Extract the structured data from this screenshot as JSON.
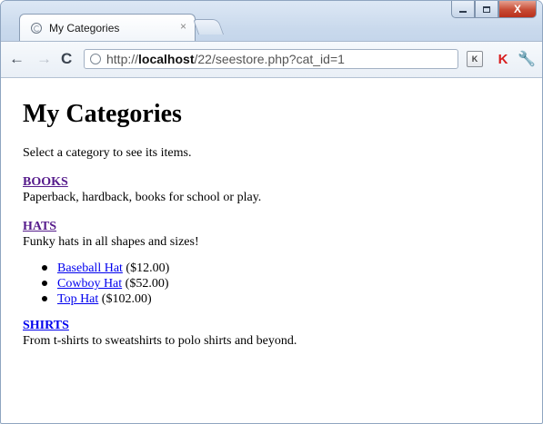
{
  "browser": {
    "tab": {
      "title": "My Categories",
      "close": "×"
    },
    "toolbar": {
      "back": "←",
      "forward": "→",
      "reload": "C",
      "url_prefix": "http://",
      "url_host": "localhost",
      "url_path": "/22/seestore.php?cat_id=1",
      "ext_k": "K",
      "ext_red": "K",
      "wrench": "🔧"
    },
    "window_controls": {
      "close": "X"
    }
  },
  "page": {
    "title": "My Categories",
    "intro": "Select a category to see its items.",
    "categories": [
      {
        "name": "BOOKS",
        "description": "Paperback, hardback, books for school or play."
      },
      {
        "name": "HATS",
        "description": "Funky hats in all shapes and sizes!",
        "items": [
          {
            "name": "Baseball Hat",
            "price": "($12.00)"
          },
          {
            "name": "Cowboy Hat",
            "price": "($52.00)"
          },
          {
            "name": "Top Hat",
            "price": "($102.00)"
          }
        ]
      },
      {
        "name": "SHIRTS",
        "description": "From t-shirts to sweatshirts to polo shirts and beyond."
      }
    ]
  },
  "colors": {
    "visited_link": "#551a8b",
    "link": "#0000ee",
    "close_button": "#c74b34"
  }
}
